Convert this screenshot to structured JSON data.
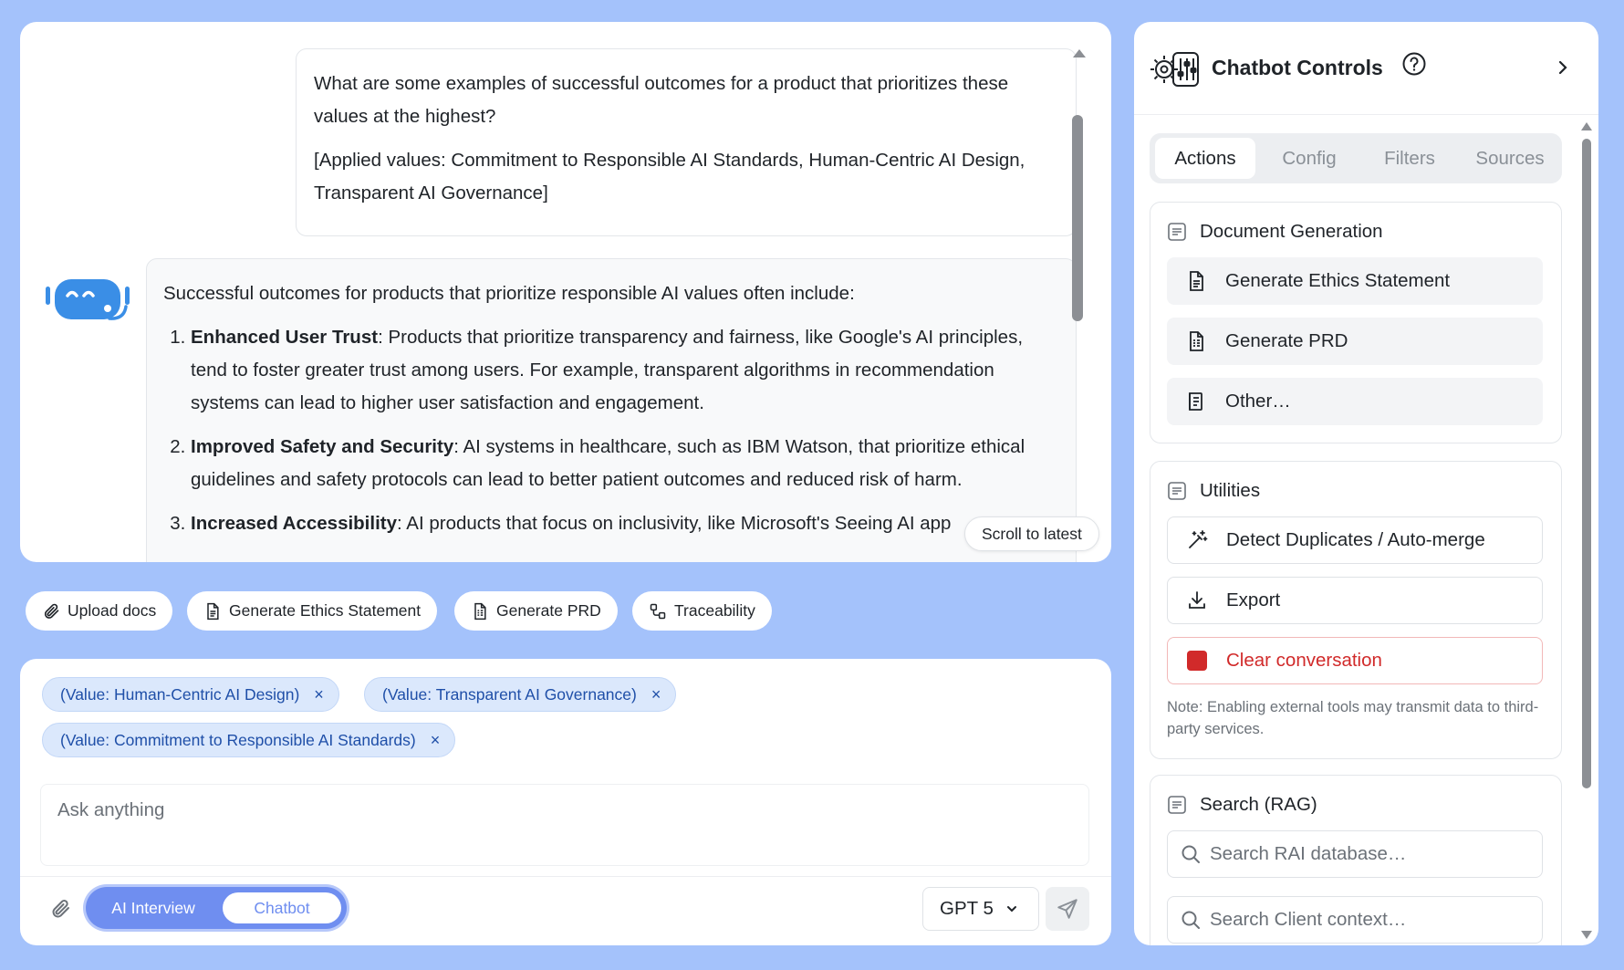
{
  "chat": {
    "user_message": {
      "line1": "What are some examples of successful outcomes for a product that prioritizes these values at the highest?",
      "line2": "[Applied values: Commitment to Responsible AI Standards, Human-Centric AI Design, Transparent AI Governance]"
    },
    "assistant_message": {
      "intro": "Successful outcomes for products that prioritize responsible AI values often include:",
      "items": [
        {
          "title": "Enhanced User Trust",
          "text": ": Products that prioritize transparency and fairness, like Google's AI principles, tend to foster greater trust among users. For example, transparent algorithms in recommendation systems can lead to higher user satisfaction and engagement."
        },
        {
          "title": "Improved Safety and Security",
          "text": ": AI systems in healthcare, such as IBM Watson, that prioritize ethical guidelines and safety protocols can lead to better patient outcomes and reduced risk of harm."
        },
        {
          "title": "Increased Accessibility",
          "text": ": AI products that focus on inclusivity, like Microsoft's Seeing AI app"
        }
      ]
    },
    "scroll_to_latest": "Scroll to latest"
  },
  "quick_actions": {
    "upload": "Upload docs",
    "ethics": "Generate Ethics Statement",
    "prd": "Generate PRD",
    "traceability": "Traceability"
  },
  "composer": {
    "chips": [
      "(Value: Human-Centric AI Design)",
      "(Value: Transparent AI Governance)",
      "(Value: Commitment to Responsible AI Standards)"
    ],
    "chip_remove": "×",
    "placeholder": "Ask anything",
    "mode_ai": "AI Interview",
    "mode_chatbot": "Chatbot",
    "model": "GPT 5"
  },
  "controls": {
    "title": "Chatbot Controls",
    "tabs": [
      "Actions",
      "Config",
      "Filters",
      "Sources"
    ],
    "doc_gen": {
      "title": "Document Generation",
      "items": [
        "Generate Ethics Statement",
        "Generate PRD",
        "Other…"
      ]
    },
    "utilities": {
      "title": "Utilities",
      "items": [
        "Detect Duplicates / Auto-merge",
        "Export",
        "Clear conversation"
      ],
      "note": "Note: Enabling external tools may transmit data to third-party services."
    },
    "search": {
      "title": "Search (RAG)",
      "placeholder_rai": "Search RAI database…",
      "placeholder_client": "Search Client context…"
    }
  },
  "colors": {
    "background": "#a4c2fb",
    "accent": "#6f8ef0",
    "chip_bg": "#dbe8fc",
    "chip_text": "#1f4fa8",
    "danger": "#d12a2a"
  }
}
